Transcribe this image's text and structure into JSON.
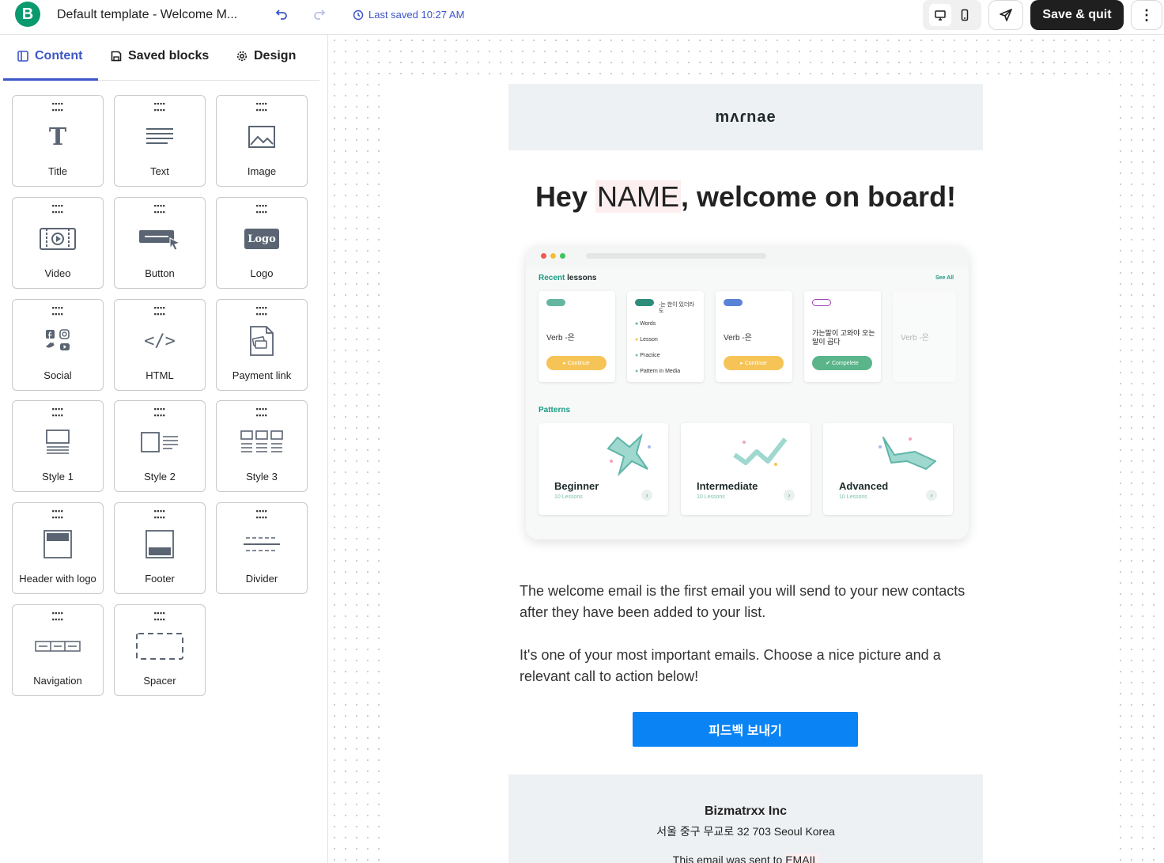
{
  "topbar": {
    "brand_letter": "B",
    "document_title": "Default template - Welcome M...",
    "last_saved": "Last saved 10:27 AM",
    "save_quit_label": "Save & quit",
    "more_label": "⋮"
  },
  "sidebar": {
    "tabs": [
      {
        "label": "Content"
      },
      {
        "label": "Saved blocks"
      },
      {
        "label": "Design"
      }
    ],
    "blocks": [
      {
        "label": "Title",
        "icon": "title-icon"
      },
      {
        "label": "Text",
        "icon": "text-icon"
      },
      {
        "label": "Image",
        "icon": "image-icon"
      },
      {
        "label": "Video",
        "icon": "video-icon"
      },
      {
        "label": "Button",
        "icon": "button-icon"
      },
      {
        "label": "Logo",
        "icon": "logo-icon"
      },
      {
        "label": "Social",
        "icon": "social-icon"
      },
      {
        "label": "HTML",
        "icon": "html-icon"
      },
      {
        "label": "Payment link",
        "icon": "payment-link-icon"
      },
      {
        "label": "Style 1",
        "icon": "style-1-icon"
      },
      {
        "label": "Style 2",
        "icon": "style-2-icon"
      },
      {
        "label": "Style 3",
        "icon": "style-3-icon"
      },
      {
        "label": "Header with logo",
        "icon": "header-with-logo-icon"
      },
      {
        "label": "Footer",
        "icon": "footer-icon"
      },
      {
        "label": "Divider",
        "icon": "divider-icon"
      },
      {
        "label": "Navigation",
        "icon": "navigation-icon"
      },
      {
        "label": "Spacer",
        "icon": "spacer-icon"
      }
    ],
    "logo_block_text": "Logo",
    "title_block_glyph": "T",
    "html_block_glyph": "</>"
  },
  "email": {
    "logo_text": "mʌɾnae",
    "headline_before": "Hey ",
    "headline_tag": "NAME",
    "headline_after": ", welcome on board!",
    "hero": {
      "recent_title_accent": "Recent",
      "recent_title_rest": " lessons",
      "see_all": "See All",
      "lessons": [
        {
          "verb": "Verb -은",
          "button": "▸ Continue"
        },
        {
          "verb": "-는 한이 있더라도",
          "items": [
            "Words",
            "Lesson",
            "Practice",
            "Pattern in Media"
          ]
        },
        {
          "verb": "Verb -은",
          "button": "▸ Continue"
        },
        {
          "verb": "가는말이 고와야 오는 말이 곱다",
          "button": "✔ Compelete"
        },
        {
          "verb": "Verb -은"
        }
      ],
      "patterns_title": "Patterns",
      "patterns": [
        {
          "label": "Beginner",
          "sub": "10 Lessons"
        },
        {
          "label": "Intermediate",
          "sub": "10 Lessons"
        },
        {
          "label": "Advanced",
          "sub": "10 Lessons"
        }
      ]
    },
    "paragraph_1": "The welcome email is the first email you will send to your new contacts after they have been added to your list.",
    "paragraph_2": "It's one of your most important emails. Choose a nice picture and a relevant call to action below!",
    "cta_label": "피드백 보내기",
    "footer": {
      "company": "Bizmatrxx Inc",
      "address": "서울 중구 무교로 32 703 Seoul Korea",
      "sent_before": "This email was sent to ",
      "sent_tag": "EMAIL"
    }
  },
  "colors": {
    "accent": "#3c55c7",
    "brand": "#0b996e",
    "cta": "#0a84f5",
    "save_button": "#1f1f1f"
  }
}
